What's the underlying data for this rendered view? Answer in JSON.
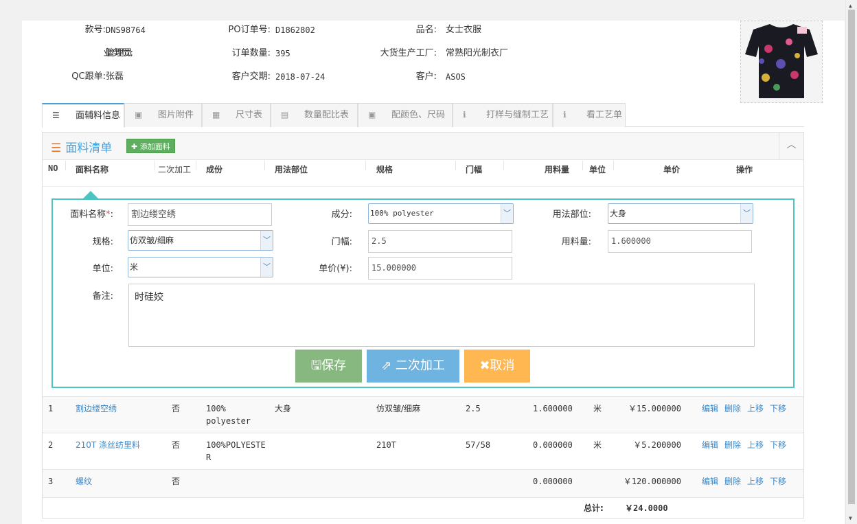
{
  "order_info": {
    "style_no_label": "款号:",
    "style_no": "DNS98764",
    "po_label": "PO订单号:",
    "po": "D1862802",
    "product_label": "品名:",
    "product": "女士衣服",
    "salesman_label": "业务员:",
    "salesman": "管理员",
    "qty_label": "订单数量:",
    "qty": "395",
    "factory_label": "大货生产工厂:",
    "factory": "常熟阳光制衣厂",
    "qc_label": "QC跟单:",
    "qc": "张磊",
    "delivery_label": "客户交期:",
    "delivery": "2018-07-24",
    "customer_label": "客户:",
    "customer": "ASOS"
  },
  "tabs": [
    {
      "label": "面辅料信息",
      "icon": "list-icon",
      "active": true
    },
    {
      "label": "图片附件",
      "icon": "image-icon"
    },
    {
      "label": "尺寸表",
      "icon": "table-icon"
    },
    {
      "label": "数量配比表",
      "icon": "grid-icon"
    },
    {
      "label": "配颜色、尺码",
      "icon": "image-icon"
    },
    {
      "label": "打样与缝制工艺",
      "icon": "info-icon"
    },
    {
      "label": "看工艺单",
      "icon": "info-icon"
    }
  ],
  "panel": {
    "title": "面料清单",
    "add_label": "添加面料",
    "collapse_icon": "chevron-up-icon"
  },
  "columns": [
    "NO",
    "面料名称",
    "二次加工",
    "成份",
    "用法部位",
    "规格",
    "门幅",
    "用料量",
    "单位",
    "单价",
    "操作"
  ],
  "form": {
    "name_label": "面料名称",
    "name_required": "*",
    "name_colon": ":",
    "name_value": "割边缕空绣",
    "composition_label": "成分:",
    "composition_value": "100% polyester",
    "usage_label": "用法部位:",
    "usage_value": "大身",
    "spec_label": "规格:",
    "spec_value": "仿双皱/细麻",
    "width_label": "门幅:",
    "width_value": "2.5",
    "amount_label": "用料量:",
    "amount_value": "1.600000",
    "unit_label": "单位:",
    "unit_value": "米",
    "price_label": "单价(¥):",
    "price_value": "15.000000",
    "note_label": "备注:",
    "note_value": "时硅姣",
    "save_label": "保存",
    "secondary_label": "二次加工",
    "cancel_label": "取消"
  },
  "rows": [
    {
      "no": "1",
      "name": "割边缕空绣",
      "secondary": "否",
      "comp1": "100%",
      "comp2": "polyester",
      "usage": "大身",
      "spec": "仿双皱/细麻",
      "width": "2.5",
      "amount": "1.600000",
      "unit": "米",
      "price": "￥15.000000"
    },
    {
      "no": "2",
      "name": "210T 涤丝纺里料",
      "secondary": "否",
      "comp1": "100%POLYESTE",
      "comp2": "R",
      "usage": "",
      "spec": "210T",
      "width": "57/58",
      "amount": "0.000000",
      "unit": "米",
      "price": "￥5.200000"
    },
    {
      "no": "3",
      "name": "螺纹",
      "secondary": "否",
      "comp1": "",
      "comp2": "",
      "usage": "",
      "spec": "",
      "width": "",
      "amount": "0.000000",
      "unit": "",
      "price": "￥120.000000"
    }
  ],
  "ops": {
    "edit": "编辑",
    "delete": "删除",
    "up": "上移",
    "down": "下移"
  },
  "total": {
    "label": "总计:",
    "value": "￥24.0000"
  }
}
